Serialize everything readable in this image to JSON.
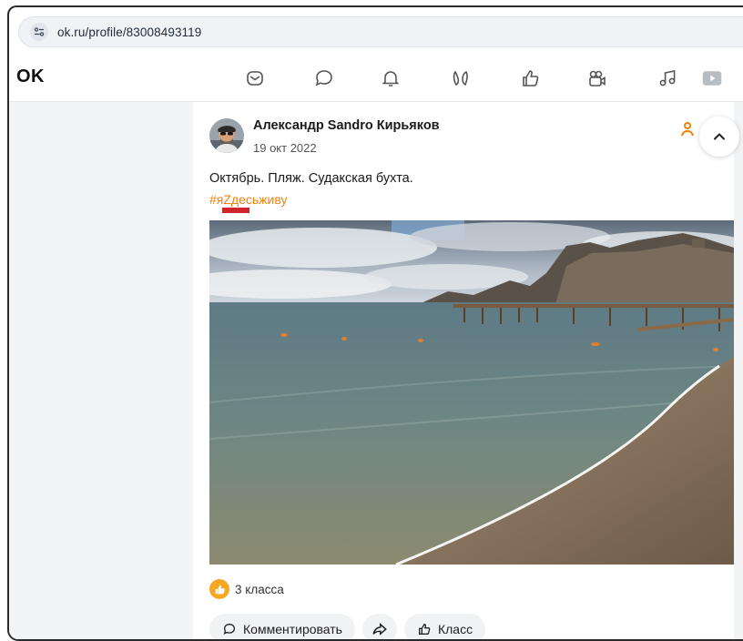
{
  "browser": {
    "url": "ok.ru/profile/83008493119"
  },
  "header": {
    "logo": "OK",
    "nav_icons": [
      "messages-icon",
      "discussions-icon",
      "notifications-icon",
      "guests-icon",
      "likes-icon",
      "video-icon",
      "music-icon",
      "video-play-icon"
    ]
  },
  "post": {
    "author": "Александр Sandro Кирьяков",
    "date": "19 окт 2022",
    "text": "Октябрь. Пляж. Судакская бухта.",
    "hashtag": "#яZдесьживу",
    "likes_count": "3 класса",
    "actions": {
      "comment": "Комментировать",
      "share": "",
      "like": "Класс"
    }
  },
  "colors": {
    "accent_orange": "#ee8208",
    "like_badge": "#f7a823",
    "hashtag_marker": "#d0262b"
  }
}
